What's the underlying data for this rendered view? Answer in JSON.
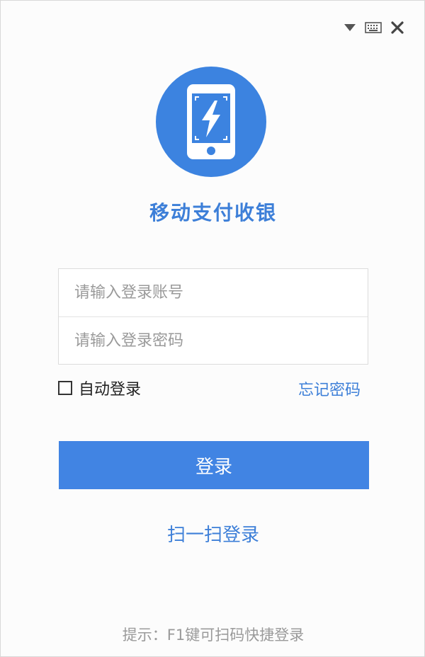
{
  "window": {
    "controls": {
      "dropdown_icon": "triangle-down",
      "keyboard_icon": "keyboard",
      "close_icon": "close-x"
    }
  },
  "app": {
    "title": "移动支付收银",
    "logo_icon": "phone-lightning",
    "accent_color": "#3c83e0"
  },
  "form": {
    "account_placeholder": "请输入登录账号",
    "account_value": "",
    "password_placeholder": "请输入登录密码",
    "password_value": ""
  },
  "options": {
    "auto_login_label": "自动登录",
    "auto_login_checked": false,
    "forgot_password_label": "忘记密码"
  },
  "actions": {
    "login_label": "登录",
    "scan_login_label": "扫一扫登录"
  },
  "footer": {
    "hint": "提示：F1键可扫码快捷登录"
  }
}
